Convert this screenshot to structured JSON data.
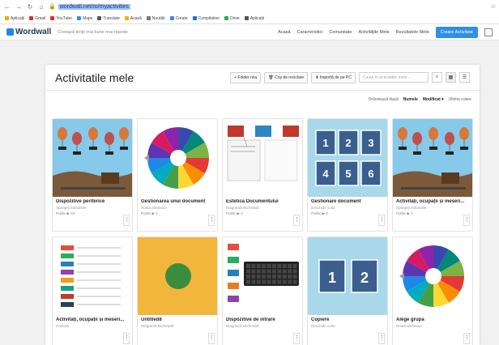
{
  "browser": {
    "url": "wordwall.net/ro/myactivities",
    "bookmarks": [
      "Aplicații",
      "Gmail",
      "YouTube",
      "Maps",
      "Translate",
      "Acasă",
      "Noutăți",
      "Create",
      "Compilation",
      "Drive",
      "Aplicații"
    ]
  },
  "site": {
    "logo": "Wordwall",
    "slogan": "Creează lecții mai bune mai repede",
    "nav": [
      "Acasă",
      "Caracteristici",
      "Comunitate",
      "Activitățile Mele",
      "Rezultatele Mele"
    ],
    "create_label": "Creare Activitate"
  },
  "page": {
    "title": "Activitatile mele",
    "new_folder": "Folder nou",
    "recycle": "Coș de reciclare",
    "import": "Importă de pe PC",
    "search_placeholder": "Caută în activitățile mele...",
    "sort_label": "Ordonează după",
    "sort_name": "Numele",
    "sort_modified": "Modificat ▾",
    "sort_last": "Ultima rulare"
  },
  "activities": [
    {
      "name": "Dispozitive periferice",
      "type": "Spargeți baloanele",
      "stats": "Public ▶ 63",
      "thumb": "balloons"
    },
    {
      "name": "Gestionarea unui document",
      "type": "Roata aleatoare",
      "stats": "Public ▶ 2",
      "thumb": "wheel"
    },
    {
      "name": "Estetica Documentului",
      "type": "Diagramă etichetată",
      "stats": "Public ▶ 2",
      "thumb": "diagram"
    },
    {
      "name": "Gestionare document",
      "type": "Deschide cutia",
      "stats": "Public ▶ 4",
      "thumb": "boxes6"
    },
    {
      "name": "Activități, ocupații și meseri...",
      "type": "Spargeți baloanele",
      "stats": "Public ▶ 2",
      "thumb": "balloons"
    },
    {
      "name": "Activități, ocupații și meseri...",
      "type": "Potrivire",
      "stats": "",
      "thumb": "list"
    },
    {
      "name": "Untitled8",
      "type": "Diagramă etichetată",
      "stats": "",
      "thumb": "green"
    },
    {
      "name": "Dispozitive de intrare",
      "type": "Diagramă etichetată",
      "stats": "",
      "thumb": "keyboard"
    },
    {
      "name": "Copiere",
      "type": "Deschide cutia",
      "stats": "",
      "thumb": "boxes2"
    },
    {
      "name": "Alege grupa",
      "type": "Roata aleatoare",
      "stats": "",
      "thumb": "wheel"
    }
  ],
  "colors": {
    "accent": "#2f8fe3",
    "sky": "#86c9e8",
    "tile": "#3a5f8f"
  }
}
